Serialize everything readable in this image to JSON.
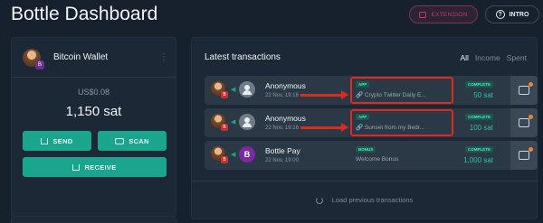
{
  "app": {
    "title": "Bottle Dashboard"
  },
  "header": {
    "extension_label": "EXTENSION",
    "intro_label": "INTRO",
    "accent_color": "#d3336c"
  },
  "wallet": {
    "name": "Bitcoin Wallet",
    "fiat_balance": "US$0.08",
    "sat_balance": "1,150 sat",
    "avatar_badge": "B",
    "send_label": "SEND",
    "scan_label": "SCAN",
    "receive_label": "RECEIVE"
  },
  "transactions": {
    "title": "Latest transactions",
    "filters": [
      "All",
      "Income",
      "Spent"
    ],
    "load_more": "Load previous transactions",
    "rows": [
      {
        "name": "Anonymous",
        "date": "22 Nov, 19:16",
        "tag": "APP",
        "description": "Crypto Twitter Daily E...",
        "status": "COMPLETE",
        "amount": "50 sat",
        "self_badge": "B"
      },
      {
        "name": "Anonymous",
        "date": "22 Nov, 19:16",
        "tag": "APP",
        "description": "Sunset from my Bedr...",
        "status": "COMPLETE",
        "amount": "100 sat",
        "self_badge": "B"
      },
      {
        "name": "Bottle Pay",
        "date": "22 Nov, 19:00",
        "tag": "BONUS",
        "description": "Welcome Bonus",
        "status": "COMPLETE",
        "amount": "1,000 sat",
        "self_badge": "B",
        "avatar_letter": "B"
      }
    ]
  }
}
